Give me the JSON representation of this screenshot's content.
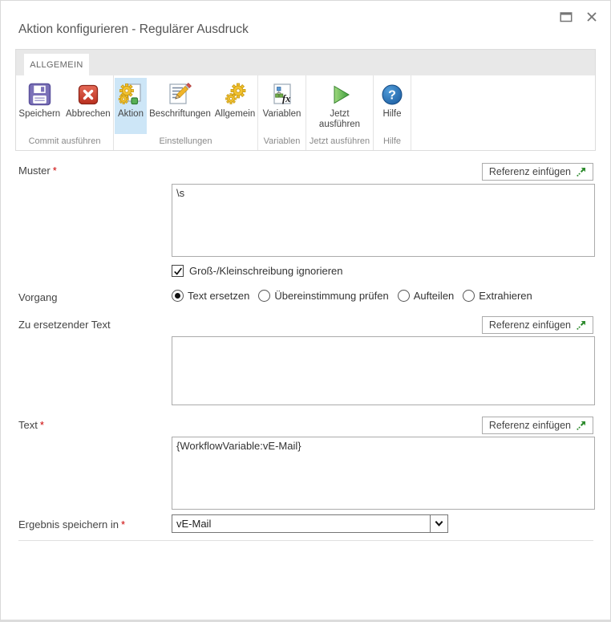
{
  "window": {
    "title": "Aktion konfigurieren - Regulärer Ausdruck"
  },
  "tabs": [
    {
      "label": "ALLGEMEIN",
      "active": true
    }
  ],
  "ribbon": {
    "groups": [
      {
        "label": "Commit ausführen",
        "buttons": [
          {
            "label": "Speichern",
            "icon": "save-floppy-icon"
          },
          {
            "label": "Abbrechen",
            "icon": "cancel-x-icon"
          }
        ]
      },
      {
        "label": "Einstellungen",
        "buttons": [
          {
            "label": "Aktion",
            "icon": "action-gears-page-icon",
            "selected": true
          },
          {
            "label": "Beschriftungen",
            "icon": "labels-pencil-icon"
          },
          {
            "label": "Allgemein",
            "icon": "general-gears-icon"
          }
        ]
      },
      {
        "label": "Variablen",
        "buttons": [
          {
            "label": "Variablen",
            "icon": "variables-fx-icon"
          }
        ]
      },
      {
        "label": "Jetzt ausführen",
        "buttons": [
          {
            "label": "Jetzt ausführen",
            "icon": "run-now-play-icon"
          }
        ]
      },
      {
        "label": "Hilfe",
        "buttons": [
          {
            "label": "Hilfe",
            "icon": "help-icon"
          }
        ]
      }
    ]
  },
  "form": {
    "insert_reference_label": "Referenz einfügen",
    "required_marker": "*",
    "muster": {
      "label": "Muster",
      "required": true,
      "value": "\\s"
    },
    "ignore_case": {
      "label": "Groß-/Kleinschreibung ignorieren",
      "checked": true
    },
    "vorgang": {
      "label": "Vorgang",
      "options": [
        "Text ersetzen",
        "Übereinstimmung prüfen",
        "Aufteilen",
        "Extrahieren"
      ],
      "selected": "Text ersetzen"
    },
    "replace_target": {
      "label": "Zu ersetzender Text",
      "value": ""
    },
    "text": {
      "label": "Text",
      "required": true,
      "value": "{WorkflowVariable:vE-Mail}"
    },
    "store_result": {
      "label": "Ergebnis speichern in",
      "required": true,
      "value": "vE-Mail"
    }
  },
  "icons": {
    "help_glyph": "?",
    "fx_glyph": "fx"
  },
  "colors": {
    "accent_selected": "#cde6f7",
    "required_red": "#cc0000",
    "reference_arrow_green": "#2e8b2e",
    "run_green": "#4caf50",
    "help_blue": "#2277bb",
    "cancel_red": "#cc3b2f",
    "save_purple": "#7b71b8",
    "tabstrip_gray": "#e8e8e8"
  }
}
